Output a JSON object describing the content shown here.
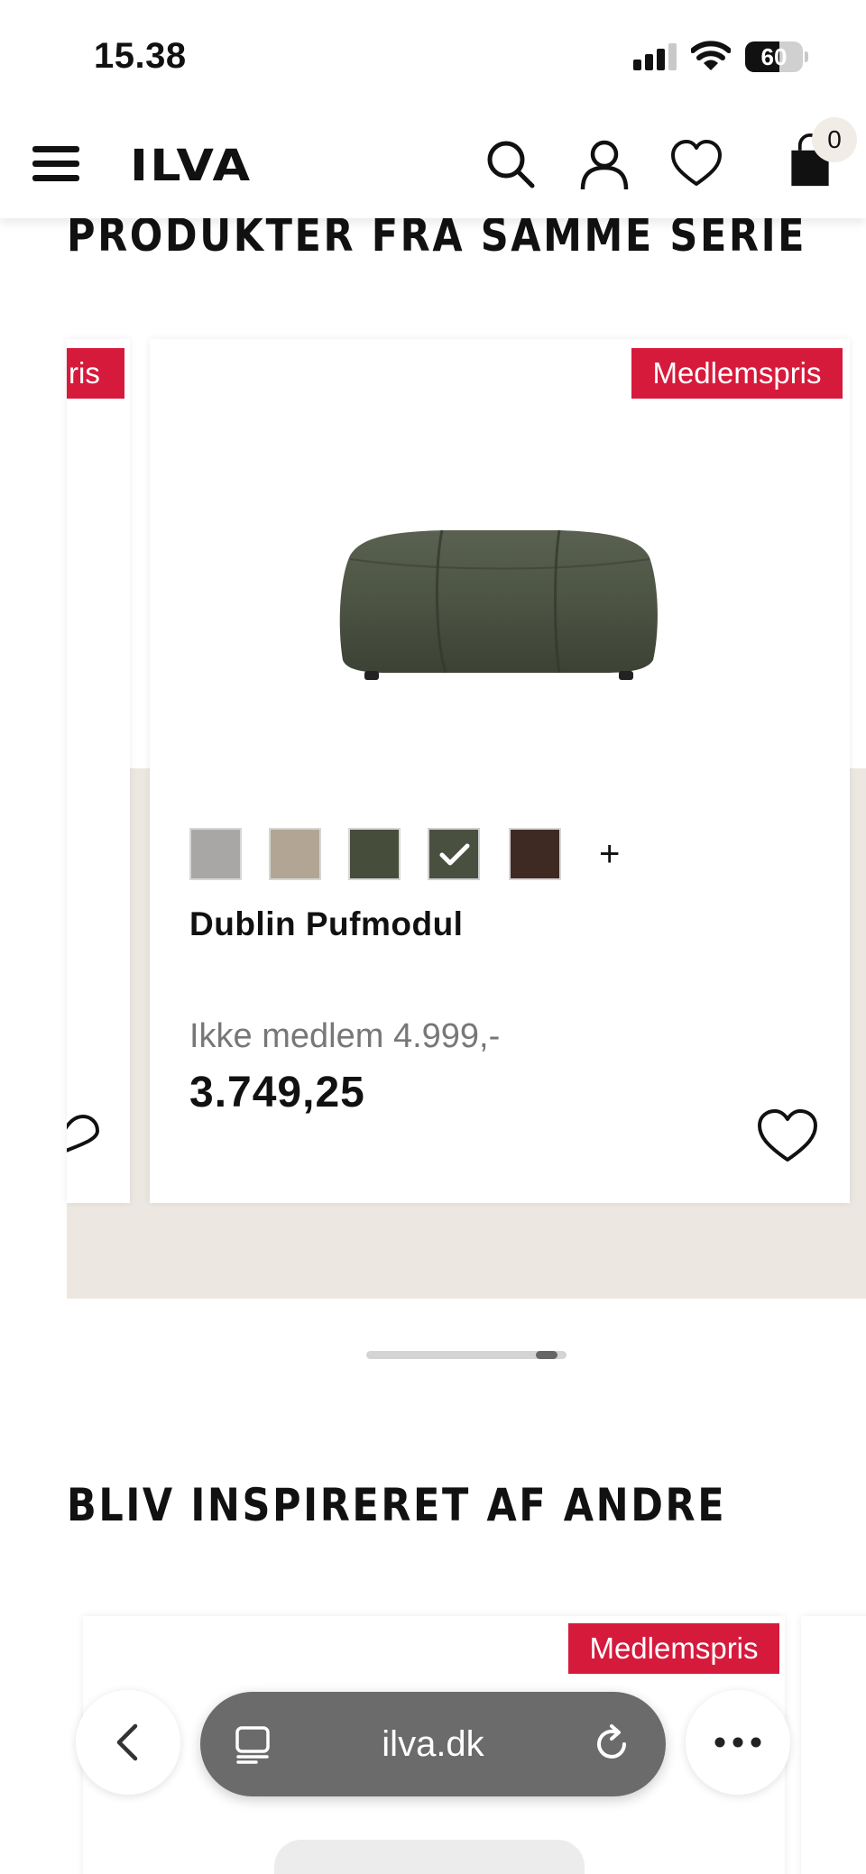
{
  "status_bar": {
    "time": "15.38",
    "battery_level": "60",
    "battery_fraction": 0.6
  },
  "header": {
    "logo": "ILVA",
    "cart_count": "0",
    "icons": [
      "menu-icon",
      "search-icon",
      "account-icon",
      "heart-icon",
      "bag-icon"
    ]
  },
  "series_section": {
    "title": "PRODUKTER FRA SAMME SERIE",
    "prev_card": {
      "badge_partial": "ris"
    },
    "product": {
      "badge": "Medlemspris",
      "name": "Dublin Pufmodul",
      "non_member_price": "Ikke medlem 4.999,-",
      "member_price": "3.749,25",
      "swatches": [
        {
          "color": "#a8a7a5",
          "selected": false
        },
        {
          "color": "#b2a594",
          "selected": false
        },
        {
          "color": "#474d3b",
          "selected": false
        },
        {
          "color": "#4a5040",
          "selected": true
        },
        {
          "color": "#3e2a22",
          "selected": false
        }
      ],
      "more_colors_label": "+"
    },
    "carousel_progress": 0.95
  },
  "inspire_section": {
    "title": "BLIV INSPIRERET AF ANDRE",
    "card_badge": "Medlemspris"
  },
  "browser": {
    "url": "ilva.dk",
    "icons": [
      "back-icon",
      "tabs-icon",
      "reload-icon",
      "more-icon"
    ]
  },
  "colors": {
    "accent_red": "#d61a3c",
    "beige": "#ede7e2",
    "product_green": "#4d5543"
  }
}
